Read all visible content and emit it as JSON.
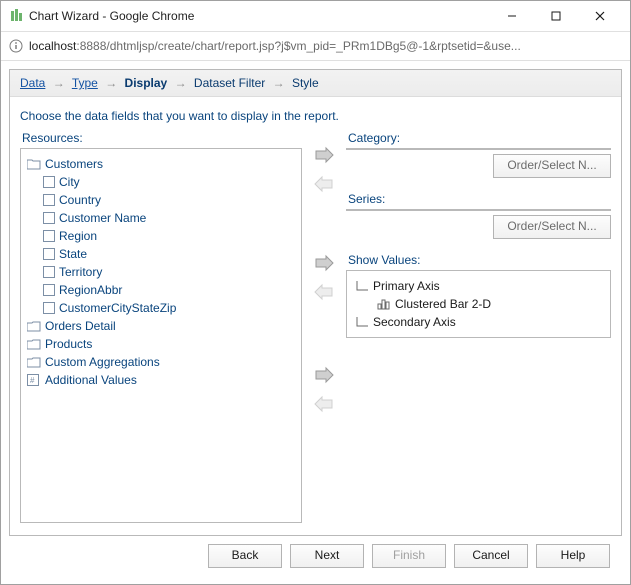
{
  "window": {
    "title": "Chart Wizard - Google Chrome",
    "url_host": "localhost",
    "url_rest": ":8888/dhtmljsp/create/chart/report.jsp?j$vm_pid=_PRm1DBg5@-1&rptsetid=&use..."
  },
  "breadcrumb": {
    "data": "Data",
    "type": "Type",
    "display": "Display",
    "dataset_filter": "Dataset Filter",
    "style": "Style"
  },
  "instruction": "Choose the data fields that you want to display in the report.",
  "resources": {
    "label": "Resources:",
    "customers": {
      "label": "Customers",
      "fields": [
        "City",
        "Country",
        "Customer Name",
        "Region",
        "State",
        "Territory",
        "RegionAbbr",
        "CustomerCityStateZip"
      ]
    },
    "orders_detail": "Orders Detail",
    "products": "Products",
    "custom_aggregations": "Custom Aggregations",
    "additional_values": "Additional Values"
  },
  "category": {
    "label": "Category:",
    "order_btn": "Order/Select N..."
  },
  "series": {
    "label": "Series:",
    "order_btn": "Order/Select N..."
  },
  "show_values": {
    "label": "Show Values:",
    "primary_axis": "Primary Axis",
    "chart_type": "Clustered Bar 2-D",
    "secondary_axis": "Secondary Axis"
  },
  "footer": {
    "back": "Back",
    "next": "Next",
    "finish": "Finish",
    "cancel": "Cancel",
    "help": "Help"
  }
}
